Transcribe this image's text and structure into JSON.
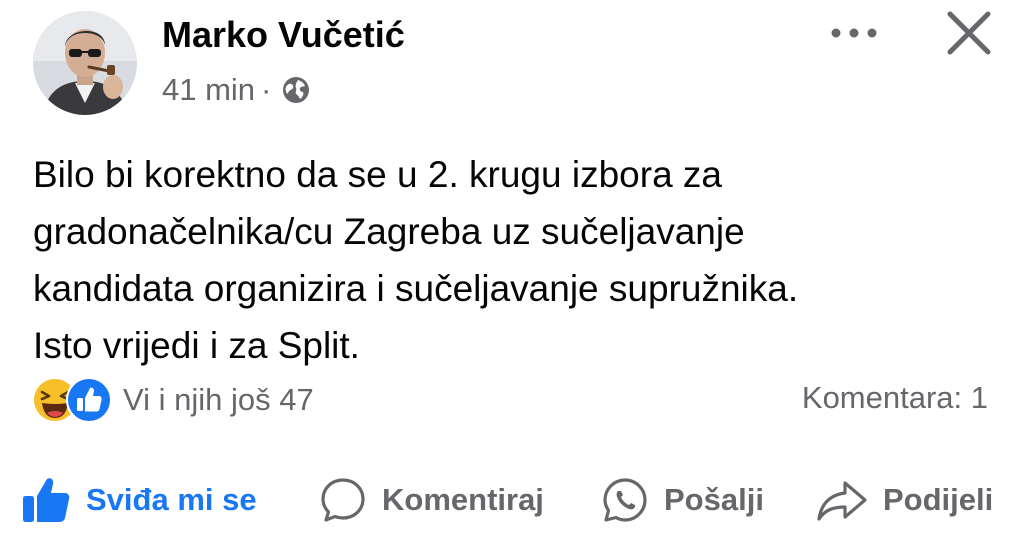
{
  "post": {
    "author": "Marko Vučetić",
    "time": "41 min",
    "separator": "·",
    "privacy_icon": "globe-icon",
    "body_lines": [
      "Bilo bi korektno da se u 2. krugu izbora za",
      "gradonačelnika/cu Zagreba uz sučeljavanje",
      "kandidata organizira i sučeljavanje supružnika.",
      "Isto vrijedi i za Split."
    ]
  },
  "header_controls": {
    "more_icon": "more-options-icon",
    "close_icon": "close-icon"
  },
  "reactions": {
    "icons": [
      "haha-emoji-icon",
      "like-reaction-icon"
    ],
    "summary": "Vi i njih još 47"
  },
  "comments": {
    "count_label": "Komentara: 1"
  },
  "actions": {
    "like": "Sviđa mi se",
    "comment": "Komentiraj",
    "send": "Pošalji",
    "share": "Podijeli"
  },
  "colors": {
    "text": "#050505",
    "secondary": "#65676b",
    "accent": "#1877f2",
    "haha_yellow": "#f7c02b"
  }
}
